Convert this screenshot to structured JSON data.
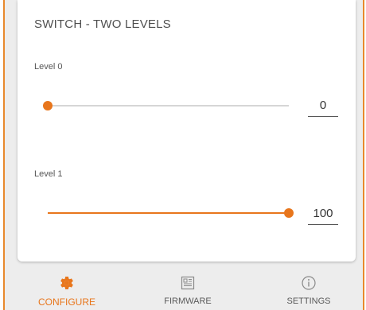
{
  "card": {
    "title": "SWITCH - TWO LEVELS",
    "levels": [
      {
        "label": "Level 0",
        "value": "0",
        "fraction": 0.0
      },
      {
        "label": "Level 1",
        "value": "100",
        "fraction": 1.0
      }
    ]
  },
  "nav": {
    "items": [
      {
        "label": "CONFIGURE",
        "icon": "gear-icon",
        "active": true
      },
      {
        "label": "FIRMWARE",
        "icon": "firmware-icon",
        "active": false
      },
      {
        "label": "SETTINGS",
        "icon": "info-icon",
        "active": false
      }
    ]
  },
  "colors": {
    "accent": "#e8761c",
    "frame": "#e8892d",
    "track": "#d6d6d6",
    "nav_bg": "#ededed"
  }
}
